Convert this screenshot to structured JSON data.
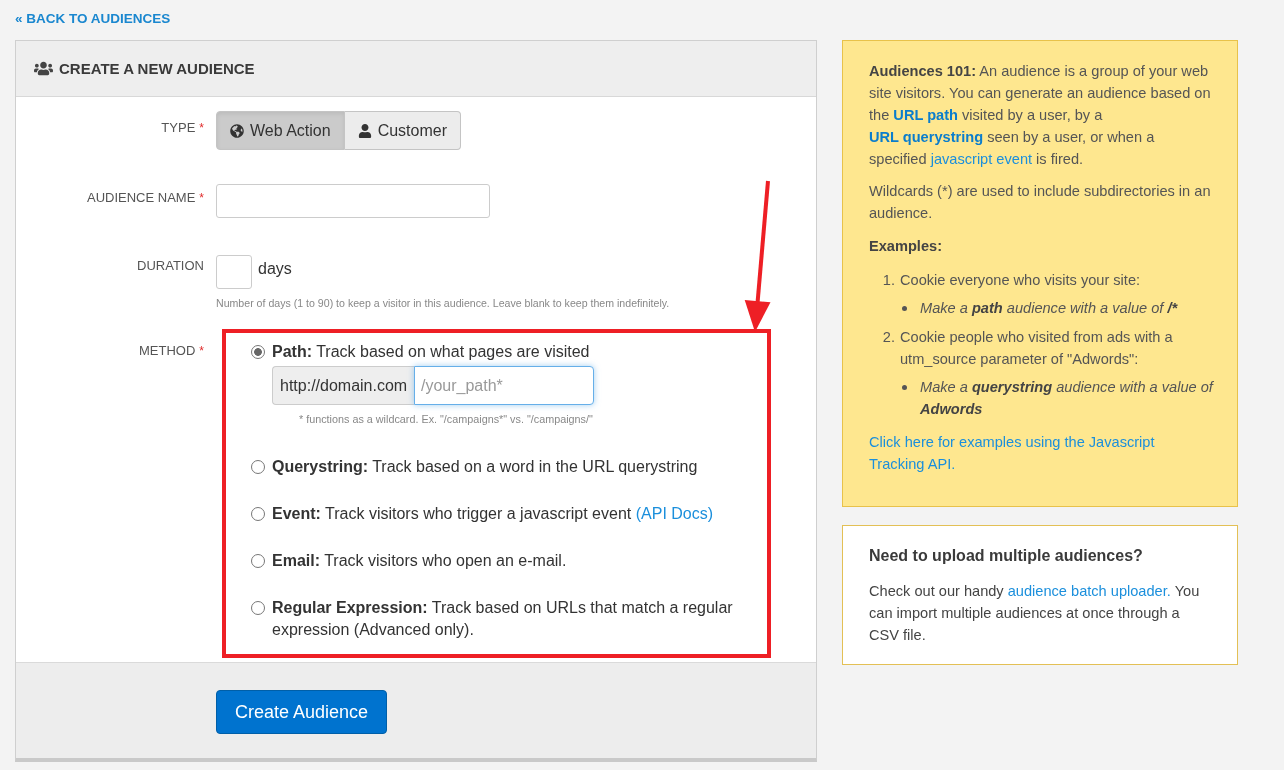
{
  "back_link": "« BACK TO AUDIENCES",
  "panel": {
    "title": "CREATE A NEW AUDIENCE"
  },
  "form": {
    "type": {
      "label": "TYPE",
      "required_mark": "*",
      "options": [
        {
          "label": "Web Action",
          "selected": true
        },
        {
          "label": "Customer",
          "selected": false
        }
      ]
    },
    "audience_name": {
      "label": "AUDIENCE NAME",
      "required_mark": "*"
    },
    "duration": {
      "label": "DURATION",
      "unit": "days",
      "help": "Number of days (1 to 90) to keep a visitor in this audience. Leave blank to keep them indefinitely."
    },
    "method": {
      "label": "METHOD",
      "required_mark": "*",
      "options": [
        {
          "name": "Path:",
          "description": "Track based on what pages are visited",
          "selected": true,
          "prefix": "http://domain.com",
          "placeholder": "/your_path*",
          "focused": true,
          "hint": "* functions as a wildcard. Ex. \"/campaigns*\" vs. \"/campaigns/\""
        },
        {
          "name": "Querystring:",
          "description": "Track based on a word in the URL querystring",
          "selected": false
        },
        {
          "name": "Event:",
          "description": "Track visitors who trigger a javascript event",
          "link": "(API Docs)",
          "selected": false
        },
        {
          "name": "Email:",
          "description": "Track visitors who open an e-mail.",
          "selected": false
        },
        {
          "name": "Regular Expression:",
          "description": "Track based on URLs that match a regular expression (Advanced only).",
          "selected": false
        }
      ]
    }
  },
  "submit_button": "Create Audience",
  "info_box": {
    "paragraphs": [
      [
        {
          "kind": "bold",
          "text": "Audiences 101:"
        },
        {
          "kind": "plain",
          "text": " An audience is a group of your web site visitors. You can generate an audience based on the "
        },
        {
          "kind": "bold_link",
          "text": "URL path"
        },
        {
          "kind": "plain",
          "text": " visited by a user, by a "
        },
        {
          "kind": "bold_link",
          "text": "URL querystring"
        },
        {
          "kind": "plain",
          "text": " seen by a user, or when a specified "
        },
        {
          "kind": "link",
          "text": "javascript event"
        },
        {
          "kind": "plain",
          "text": " is fired."
        }
      ],
      [
        {
          "kind": "plain",
          "text": "Wildcards (*) are used to include subdirectories in an audience."
        }
      ]
    ],
    "examples_heading": "Examples:",
    "examples": [
      {
        "number": "1.",
        "text": "Cookie everyone who visits your site:",
        "tips": [
          [
            {
              "kind": "plain",
              "text": "Make a "
            },
            {
              "kind": "bold",
              "text": "path"
            },
            {
              "kind": "plain",
              "text": " audience with a value of "
            },
            {
              "kind": "bold",
              "text": "/*"
            }
          ]
        ]
      },
      {
        "number": "2.",
        "text": "Cookie people who visited from ads with a utm_source parameter of \"Adwords\":",
        "tips": [
          [
            {
              "kind": "plain",
              "text": "Make a "
            },
            {
              "kind": "bold",
              "text": "querystring"
            },
            {
              "kind": "plain",
              "text": " audience with a value of "
            },
            {
              "kind": "bold",
              "text": "Adwords"
            }
          ]
        ]
      }
    ],
    "footer_link": "Click here for examples using the Javascript Tracking API."
  },
  "upload_box": {
    "title": "Need to upload multiple audiences?",
    "text": [
      {
        "kind": "plain",
        "text": "Check out our handy "
      },
      {
        "kind": "link",
        "text": "audience batch uploader."
      },
      {
        "kind": "plain",
        "text": " You can import multiple audiences at once through a CSV file."
      }
    ]
  }
}
